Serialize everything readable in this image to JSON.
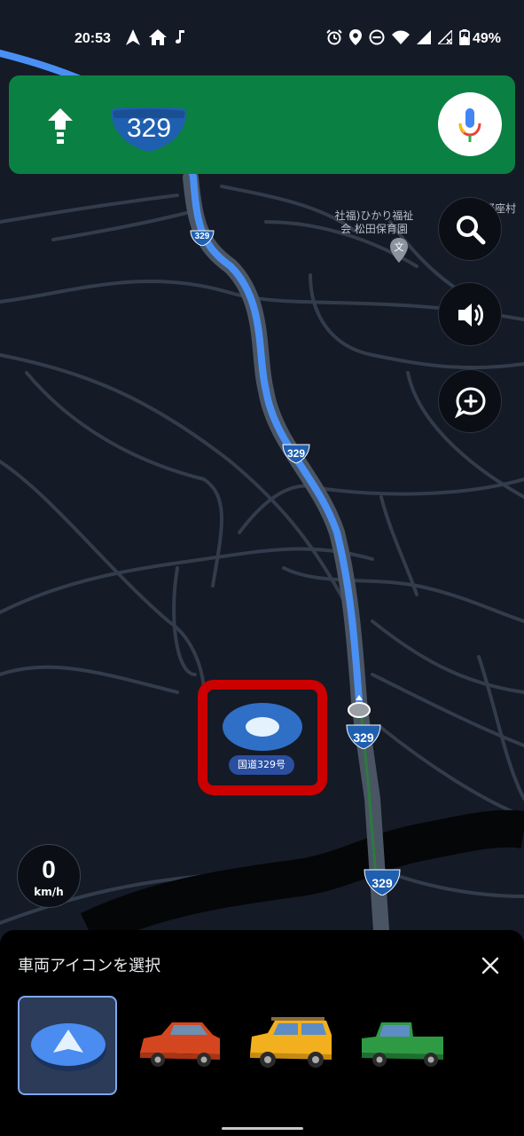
{
  "status_bar": {
    "time": "20:53",
    "battery": "49%",
    "left_icons": [
      "navigation-icon",
      "home-icon",
      "music-icon"
    ],
    "right_icons": [
      "alarm-icon",
      "location-icon",
      "dnd-icon",
      "wifi-icon",
      "signal-icon",
      "signal-off-icon",
      "battery-icon"
    ]
  },
  "navigation": {
    "maneuver": "straight-arrow-icon",
    "route_number": "329",
    "voice_search": "mic-icon"
  },
  "map": {
    "poi_name": "社福)ひかり福祉\n会 松田保育園",
    "edge_label": "野座村",
    "route_shields": [
      "329",
      "329",
      "329",
      "329"
    ],
    "road_name": "国道329号",
    "colors": {
      "route": "#4a90f4",
      "banner": "#0b8043",
      "background": "#141a26"
    }
  },
  "controls": {
    "search": "search-icon",
    "sound": "volume-icon",
    "report": "add-report-icon"
  },
  "speed": {
    "value": "0",
    "unit": "km/h"
  },
  "vehicle_sheet": {
    "title": "車両アイコンを選択",
    "close": "close-icon",
    "options": [
      {
        "name": "navigation-arrow",
        "selected": true
      },
      {
        "name": "red-car",
        "selected": false
      },
      {
        "name": "yellow-suv",
        "selected": false
      },
      {
        "name": "green-truck",
        "selected": false
      }
    ]
  }
}
